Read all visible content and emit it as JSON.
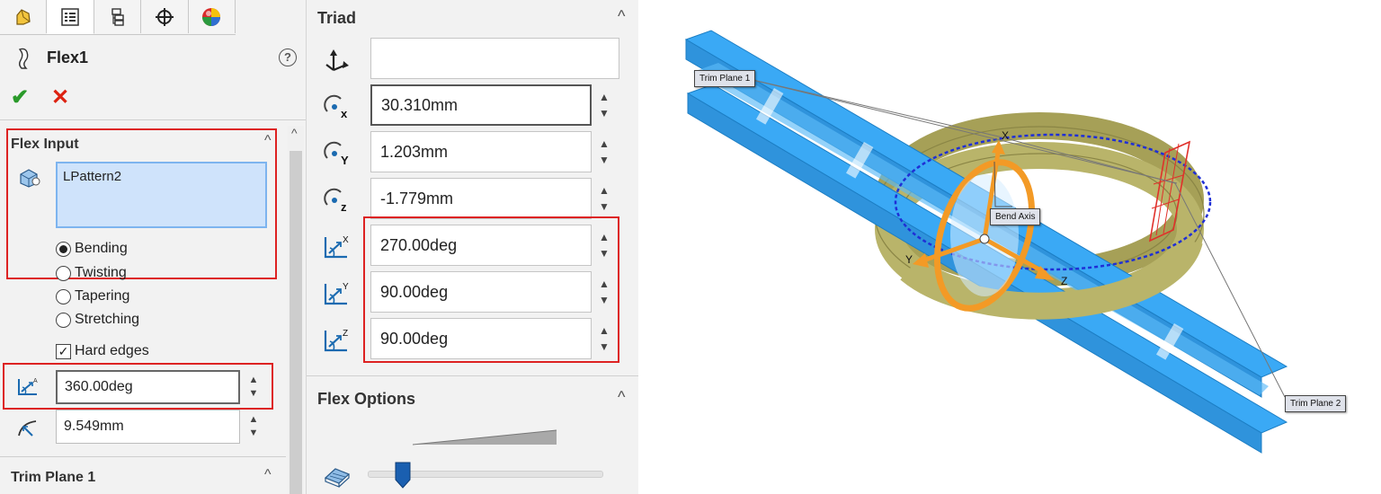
{
  "left_panel": {
    "tabs": [
      "feature-manager-tab",
      "property-manager-tab",
      "configuration-manager-tab",
      "dimxpert-tab",
      "appearance-tab"
    ],
    "title": "Flex1",
    "help_symbol": "?",
    "ok_symbol": "✔",
    "cancel_symbol": "✕",
    "flex_input": {
      "header": "Flex Input",
      "selection": "LPattern2",
      "modes": [
        {
          "label": "Bending",
          "selected": true
        },
        {
          "label": "Twisting",
          "selected": false
        },
        {
          "label": "Tapering",
          "selected": false
        },
        {
          "label": "Stretching",
          "selected": false
        }
      ],
      "hard_edges_label": "Hard edges",
      "hard_edges_checked": true,
      "angle": "360.00deg",
      "radius": "9.549mm"
    },
    "trim_plane_1_header": "Trim Plane 1"
  },
  "triad": {
    "header": "Triad",
    "selection": "",
    "x": "30.310mm",
    "y": "1.203mm",
    "z": "-1.779mm",
    "rot_x": "270.00deg",
    "rot_y": "90.00deg",
    "rot_z": "90.00deg",
    "sub_x": "x",
    "sub_y": "Y",
    "sub_z": "z",
    "rsub_x": "X",
    "rsub_y": "Y",
    "rsub_z": "Z"
  },
  "flex_options": {
    "header": "Flex Options",
    "accuracy_level": 0.15
  },
  "viewport": {
    "trim_plane_1": "Trim Plane 1",
    "trim_plane_2": "Trim Plane 2",
    "bend_axis": "Bend Axis",
    "axis_x": "X",
    "axis_y": "Y",
    "axis_z": "Z",
    "colors": {
      "bars": "#3aa9f5",
      "ring": "#b9b46a",
      "triad": "#f39a26",
      "plane": "#e0302a",
      "bend_circle": "#1f2fd6"
    }
  },
  "caret_up": "^",
  "spin_up": "▲",
  "spin_down": "▼"
}
